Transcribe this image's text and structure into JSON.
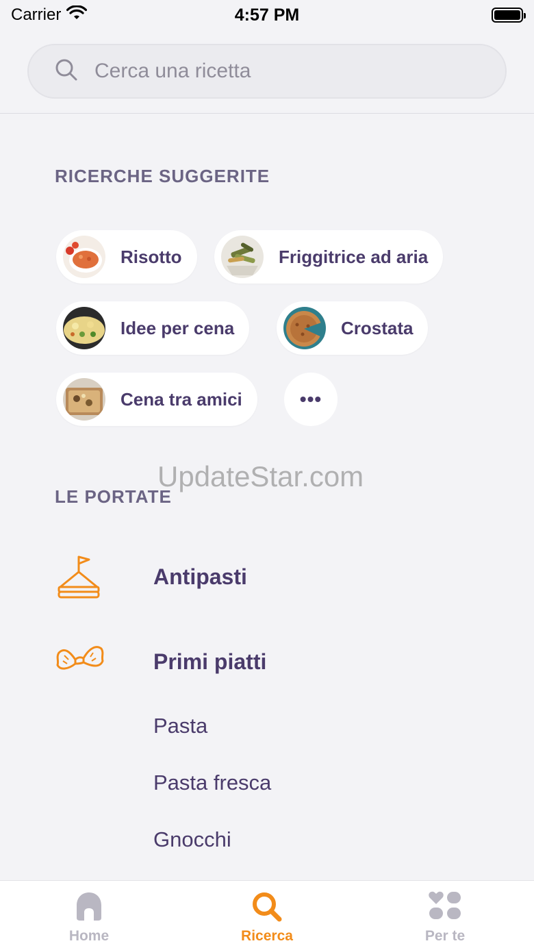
{
  "status_bar": {
    "carrier": "Carrier",
    "time": "4:57 PM"
  },
  "search": {
    "placeholder": "Cerca una ricetta"
  },
  "suggested": {
    "title": "RICERCHE SUGGERITE",
    "chips": [
      {
        "label": "Risotto"
      },
      {
        "label": "Friggitrice ad aria"
      },
      {
        "label": "Idee per cena"
      },
      {
        "label": "Crostata"
      },
      {
        "label": "Cena tra amici"
      }
    ],
    "more_label": "•••"
  },
  "watermark": "UpdateStar.com",
  "courses": {
    "title": "LE PORTATE",
    "items": [
      {
        "label": "Antipasti",
        "icon": "sandwich-icon"
      },
      {
        "label": "Primi piatti",
        "icon": "farfalle-pasta-icon"
      }
    ],
    "sub_items": [
      "Pasta",
      "Pasta fresca",
      "Gnocchi"
    ]
  },
  "tab_bar": {
    "tabs": [
      {
        "label": "Home",
        "icon": "home-icon",
        "active": false
      },
      {
        "label": "Ricerca",
        "icon": "search-icon",
        "active": true
      },
      {
        "label": "Per te",
        "icon": "grid-heart-icon",
        "active": false
      }
    ]
  },
  "colors": {
    "accent": "#f28c1a",
    "text": "#4a3b6b",
    "inactive": "#b9b7c2",
    "background": "#f3f3f6"
  }
}
